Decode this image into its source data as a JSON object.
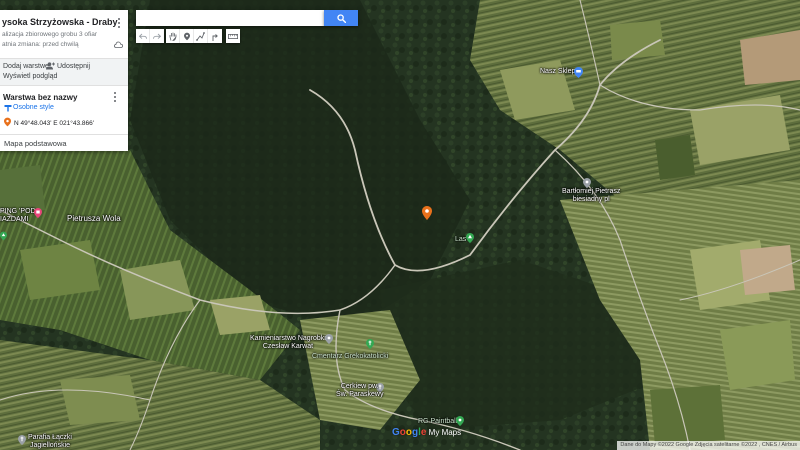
{
  "panel": {
    "title": "ysoka Strzyżowska - Draby",
    "sub1": "alizacja zbiorowego grobu 3 ofiar",
    "sub2": "atnia zmiana: przed chwilą",
    "add_layer": "Dodaj warstwę",
    "share": "Udostępnij",
    "preview": "Wyświetl podgląd",
    "layer_title": "Warstwa bez nazwy",
    "styles_link": "Osobne style",
    "point_coords": "N 49°48.043' E 021°43.866'",
    "base_map": "Mapa podstawowa"
  },
  "search": {
    "value": "",
    "placeholder": ""
  },
  "colors": {
    "accent": "#4285f4",
    "marker": "#e8711c",
    "poi_green": "#34a853",
    "poi_pink": "#e8457a"
  },
  "icons": [
    "search-icon",
    "undo-icon",
    "redo-icon",
    "hand-icon",
    "marker-icon",
    "line-icon",
    "route-icon",
    "ruler-icon",
    "cloud-icon",
    "add-person-icon",
    "style-icon"
  ],
  "map_labels": {
    "nasz_sklep": "Nasz Sklep",
    "bartlomiej_1": "Bartłomiej Pietrasz",
    "bartlomiej_2": "biesiadny pl",
    "las": "Las",
    "camping_1": "PING 'POD",
    "camping_2": "IAZDAMI",
    "pietrusza_wola": "Pietrusza Wola",
    "kamieniarstwo_1": "Kamieniarstwo Nagrobki",
    "kamieniarstwo_2": "Czesław Karwat",
    "cmentarz": "Cmentarz Grekokatolicki",
    "cerkiew_1": "Cerkiew pw.",
    "cerkiew_2": "Św. Paraskewy",
    "paintball": "RG Paintball",
    "parafia_1": "Parafia Łączki",
    "parafia_2": "Jagiellońskie"
  },
  "google_logo": "Google My Maps",
  "attribution": "Dane do Mapy ©2022 Google Zdjęcia satelitarne ©2022 , CNES / Airbus"
}
